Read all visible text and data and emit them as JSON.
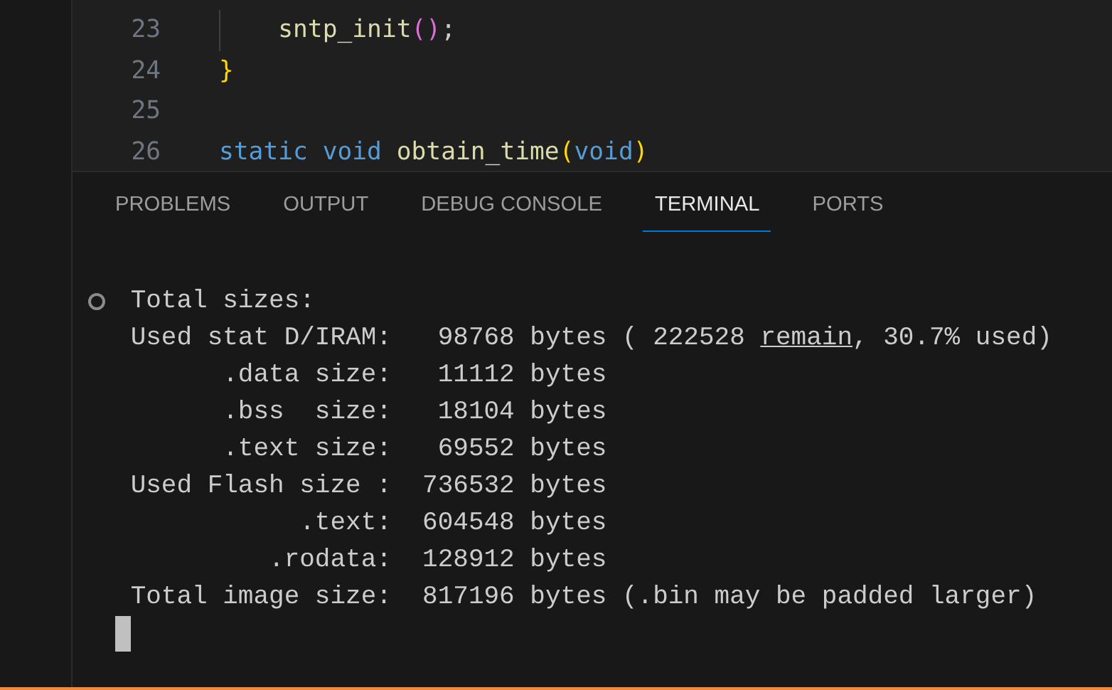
{
  "editor": {
    "lines": [
      {
        "number": "23",
        "indent_guide": true,
        "tokens": [
          {
            "kind": "function",
            "text": "sntp_init"
          },
          {
            "kind": "bracket2",
            "text": "()"
          },
          {
            "kind": "plain",
            "text": ";"
          }
        ]
      },
      {
        "number": "24",
        "tokens": [
          {
            "kind": "bracket1",
            "text": "}"
          }
        ]
      },
      {
        "number": "25"
      },
      {
        "number": "26",
        "tokens": [
          {
            "kind": "keyword",
            "text": "static",
            "space_after": true
          },
          {
            "kind": "keyword",
            "text": "void",
            "space_after": true
          },
          {
            "kind": "function",
            "text": "obtain_time"
          },
          {
            "kind": "bracket1",
            "text": "("
          },
          {
            "kind": "keyword",
            "text": "void"
          },
          {
            "kind": "bracket1",
            "text": ")"
          }
        ]
      }
    ]
  },
  "panel": {
    "tabs": [
      {
        "label": "PROBLEMS",
        "selected": false
      },
      {
        "label": "OUTPUT",
        "selected": false
      },
      {
        "label": "DEBUG CONSOLE",
        "selected": false
      },
      {
        "label": "TERMINAL",
        "selected": true
      },
      {
        "label": "PORTS",
        "selected": false
      }
    ],
    "terminal": {
      "lines": [
        {
          "decorated": true,
          "parts": [
            {
              "kind": "text",
              "text": "Total sizes:"
            }
          ]
        },
        {
          "decorated": false,
          "parts": [
            {
              "kind": "text",
              "text": "Used stat D/IRAM:   98768 bytes ( 222528 "
            },
            {
              "kind": "link",
              "text": "remain"
            },
            {
              "kind": "text",
              "text": ", 30.7% used)"
            }
          ]
        },
        {
          "decorated": false,
          "parts": [
            {
              "kind": "text",
              "text": "      .data size:   11112 bytes"
            }
          ]
        },
        {
          "decorated": false,
          "parts": [
            {
              "kind": "text",
              "text": "      .bss  size:   18104 bytes"
            }
          ]
        },
        {
          "decorated": false,
          "parts": [
            {
              "kind": "text",
              "text": "      .text size:   69552 bytes"
            }
          ]
        },
        {
          "decorated": false,
          "parts": [
            {
              "kind": "text",
              "text": "Used Flash size :  736532 bytes"
            }
          ]
        },
        {
          "decorated": false,
          "parts": [
            {
              "kind": "text",
              "text": "           .text:  604548 bytes"
            }
          ]
        },
        {
          "decorated": false,
          "parts": [
            {
              "kind": "text",
              "text": "         .rodata:  128912 bytes"
            }
          ]
        },
        {
          "decorated": false,
          "parts": [
            {
              "kind": "text",
              "text": "Total image size:  817196 bytes (.bin may be padded larger)"
            }
          ]
        }
      ],
      "cursor": true
    }
  }
}
